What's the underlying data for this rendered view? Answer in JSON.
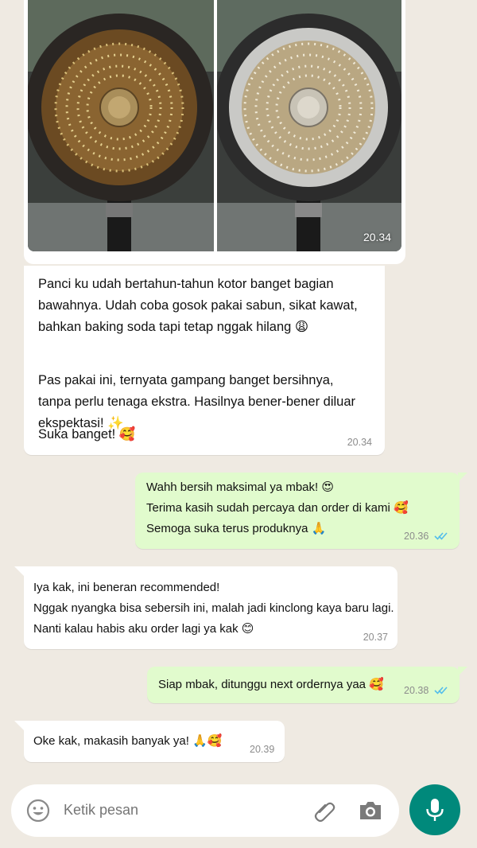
{
  "image_message": {
    "time": "20.34",
    "left_photo": "dirty-pan-bottom",
    "right_photo": "clean-pan-bottom"
  },
  "messages": [
    {
      "direction": "in",
      "paragraphs": [
        "Panci ku udah bertahun-tahun kotor banget bagian",
        "bawahnya. Udah coba gosok pakai sabun, sikat kawat,",
        "bahkan baking soda tapi tetap nggak hilang 😩",
        "Pas pakai ini, ternyata gampang banget bersihnya,",
        "tanpa perlu tenaga ekstra. Hasilnya bener-bener diluar",
        "ekspektasi! ✨",
        "Suka banget! 🥰"
      ],
      "time": "20.34"
    },
    {
      "direction": "out",
      "lines": [
        "Wahh bersih maksimal ya mbak! 😍",
        "Terima kasih sudah percaya dan order di kami 🥰",
        "Semoga suka terus produknya 🙏"
      ],
      "time": "20.36",
      "status": "read"
    },
    {
      "direction": "in",
      "lines": [
        "Iya kak, ini beneran recommended!",
        "Nggak nyangka bisa sebersih ini, malah jadi kinclong kaya baru lagi.",
        "Nanti kalau habis aku order lagi ya kak 😊"
      ],
      "time": "20.37"
    },
    {
      "direction": "out",
      "lines": [
        "Siap mbak, ditunggu next ordernya yaa 🥰"
      ],
      "time": "20.38",
      "status": "read"
    },
    {
      "direction": "in",
      "lines": [
        "Oke kak, makasih banyak ya! 🙏🥰"
      ],
      "time": "20.39"
    }
  ],
  "composer": {
    "placeholder": "Ketik pesan",
    "icons": [
      "emoji-icon",
      "attach-icon",
      "camera-icon",
      "mic-icon"
    ]
  },
  "colors": {
    "background": "#efeae2",
    "incoming": "#ffffff",
    "outgoing": "#e1fbcd",
    "read_ticks": "#53bdeb",
    "mic_button": "#00897b"
  }
}
